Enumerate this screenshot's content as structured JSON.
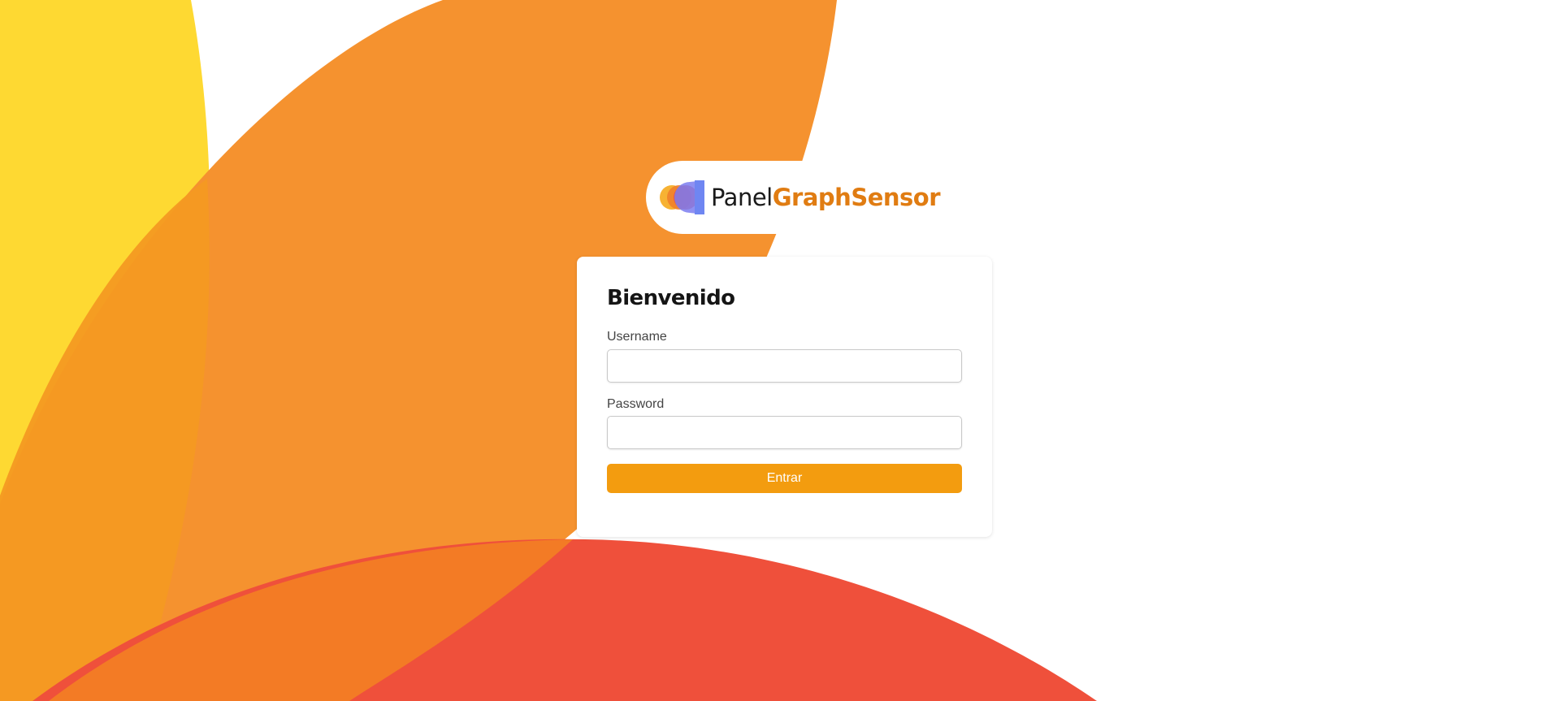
{
  "brand": {
    "name_part1": "Panel",
    "name_part2": "GraphSensor",
    "logo_icon": "layered-circles-logo-icon"
  },
  "login": {
    "title": "Bienvenido",
    "username_label": "Username",
    "username_value": "",
    "password_label": "Password",
    "password_value": "",
    "submit_label": "Entrar"
  },
  "colors": {
    "yellow": "#fed932",
    "orange": "#f5922f",
    "orange_dark": "#f3a021",
    "red": "#ef503b",
    "accent": "#f39c0f",
    "brand_orange": "#e07c12"
  }
}
